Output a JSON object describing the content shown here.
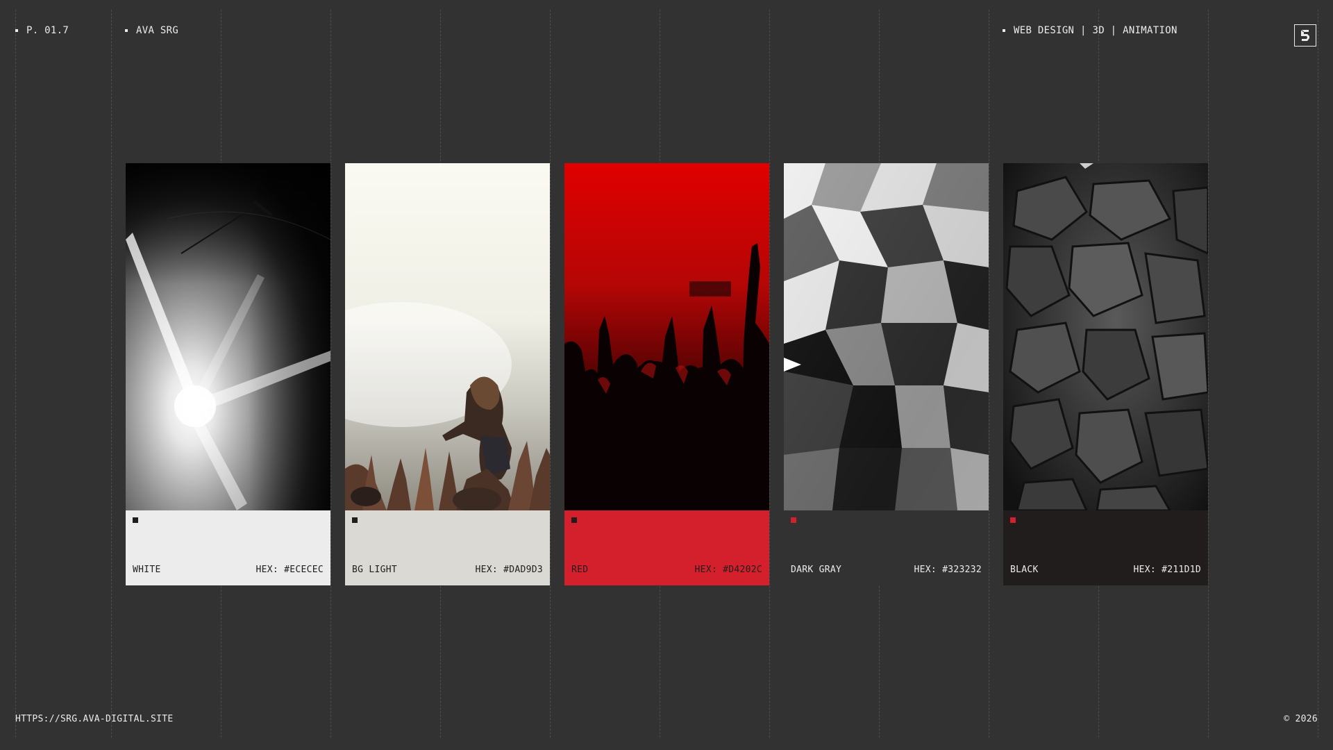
{
  "header": {
    "page_number": "P. 01.7",
    "author": "AVA SRG",
    "tags": "WEB DESIGN | 3D | ANIMATION",
    "logo_icon": "brand-logo-icon"
  },
  "footer": {
    "url": "HTTPS://SRG.AVA-DIGITAL.SITE",
    "copyright": "© 2026"
  },
  "palette": [
    {
      "name": "WHITE",
      "hex_label": "HEX: #ECECEC",
      "color": "#ECECEC",
      "marker_color": "#211D1D",
      "text_color": "#211D1D",
      "photo": "stage-light-beams"
    },
    {
      "name": "BG LIGHT",
      "hex_label": "HEX: #DAD9D3",
      "color": "#DAD9D3",
      "marker_color": "#211D1D",
      "text_color": "#211D1D",
      "photo": "singer-crowd-haze"
    },
    {
      "name": "RED",
      "hex_label": "HEX: #D4202C",
      "color": "#D4202C",
      "marker_color": "#211D1D",
      "text_color": "#211D1D",
      "photo": "red-concert-crowd"
    },
    {
      "name": "DARK GRAY",
      "hex_label": "HEX: #323232",
      "color": "#323232",
      "marker_color": "#D4202C",
      "text_color": "#ECECEC",
      "photo": "crumpled-foil"
    },
    {
      "name": "BLACK",
      "hex_label": "HEX: #211D1D",
      "color": "#211D1D",
      "marker_color": "#D4202C",
      "text_color": "#ECECEC",
      "photo": "cracked-texture"
    }
  ]
}
